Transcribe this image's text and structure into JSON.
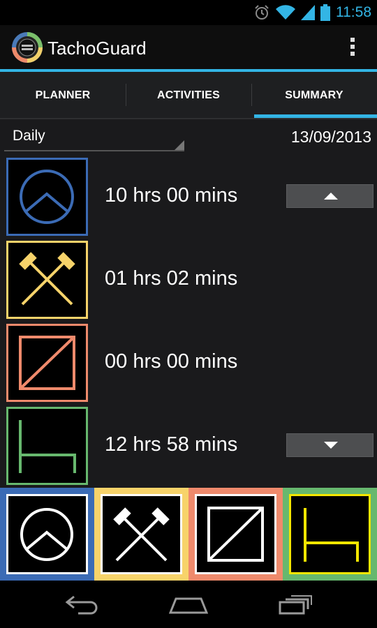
{
  "status_bar": {
    "time": "11:58",
    "icons": [
      "alarm-icon",
      "wifi-icon",
      "signal-icon",
      "battery-icon"
    ],
    "accent": "#33b5e5"
  },
  "action_bar": {
    "title": "TachoGuard",
    "logo": "tachoguard-logo-icon",
    "overflow": "overflow-menu-icon"
  },
  "tabs": [
    {
      "label": "PLANNER",
      "active": false
    },
    {
      "label": "ACTIVITIES",
      "active": false
    },
    {
      "label": "SUMMARY",
      "active": true
    }
  ],
  "filter": {
    "period": "Daily",
    "date": "13/09/2013"
  },
  "summary_rows": [
    {
      "icon": "driving-icon",
      "color": "#3b6bb5",
      "duration": "10 hrs 00 mins"
    },
    {
      "icon": "work-hammers-icon",
      "color": "#f7d36a",
      "duration": "01 hrs 02 mins"
    },
    {
      "icon": "availability-icon",
      "color": "#ef8a6c",
      "duration": "00 hrs 00 mins"
    },
    {
      "icon": "rest-bed-icon",
      "color": "#67b86e",
      "duration": "12 hrs 58 mins"
    }
  ],
  "scroll_buttons": {
    "up_icon": "arrow-up-icon",
    "down_icon": "arrow-down-icon"
  },
  "activity_buttons": [
    {
      "icon": "driving-icon",
      "bg_color": "#3b6bb5",
      "symbol_color": "#ffffff"
    },
    {
      "icon": "work-hammers-icon",
      "bg_color": "#f7d36a",
      "symbol_color": "#ffffff"
    },
    {
      "icon": "availability-icon",
      "bg_color": "#ef8a6c",
      "symbol_color": "#ffffff"
    },
    {
      "icon": "rest-bed-icon",
      "bg_color": "#67b86e",
      "symbol_color": "#f5e600"
    }
  ],
  "nav_bar": [
    "back-icon",
    "home-icon",
    "recent-apps-icon"
  ]
}
